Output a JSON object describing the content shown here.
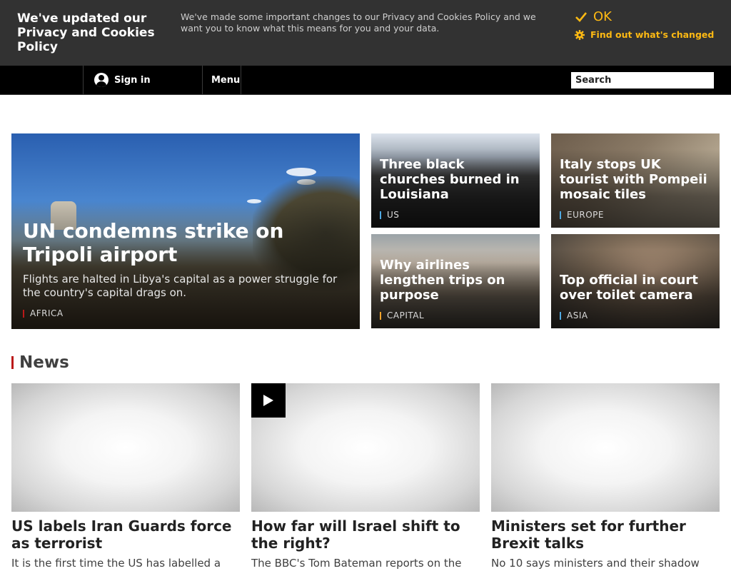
{
  "cookie_banner": {
    "title": "We've updated our Privacy and Cookies Policy",
    "text": "We've made some important changes to our Privacy and Cookies Policy and we want you to know what this means for you and your data.",
    "ok_label": "OK",
    "find_out_label": "Find out what's changed",
    "accent_color": "#fdb913"
  },
  "nav": {
    "signin_label": "Sign in",
    "menu_label": "Menu",
    "search_placeholder": "Search"
  },
  "hero": {
    "title": "UN condemns strike on Tripoli airport",
    "summary": "Flights are halted in Libya's capital as a power struggle for the country's capital drags on.",
    "tag": "AFRICA"
  },
  "cards": [
    {
      "title": "Three black churches burned in Louisiana",
      "tag": "US"
    },
    {
      "title": "Italy stops UK tourist with Pompeii mosaic tiles",
      "tag": "EUROPE"
    },
    {
      "title": "Why airlines lengthen trips on purpose",
      "tag": "CAPITAL"
    },
    {
      "title": "Top official in court over toilet camera",
      "tag": "ASIA"
    }
  ],
  "news": {
    "heading": "News",
    "items": [
      {
        "title": "US labels Iran Guards force as terrorist",
        "summary": "It is the first time the US has labelled a"
      },
      {
        "title": "How far will Israel shift to the right?",
        "summary": "The BBC's Tom Bateman reports on the"
      },
      {
        "title": "Ministers set for further Brexit talks",
        "summary": "No 10 says ministers and their shadow"
      }
    ]
  }
}
